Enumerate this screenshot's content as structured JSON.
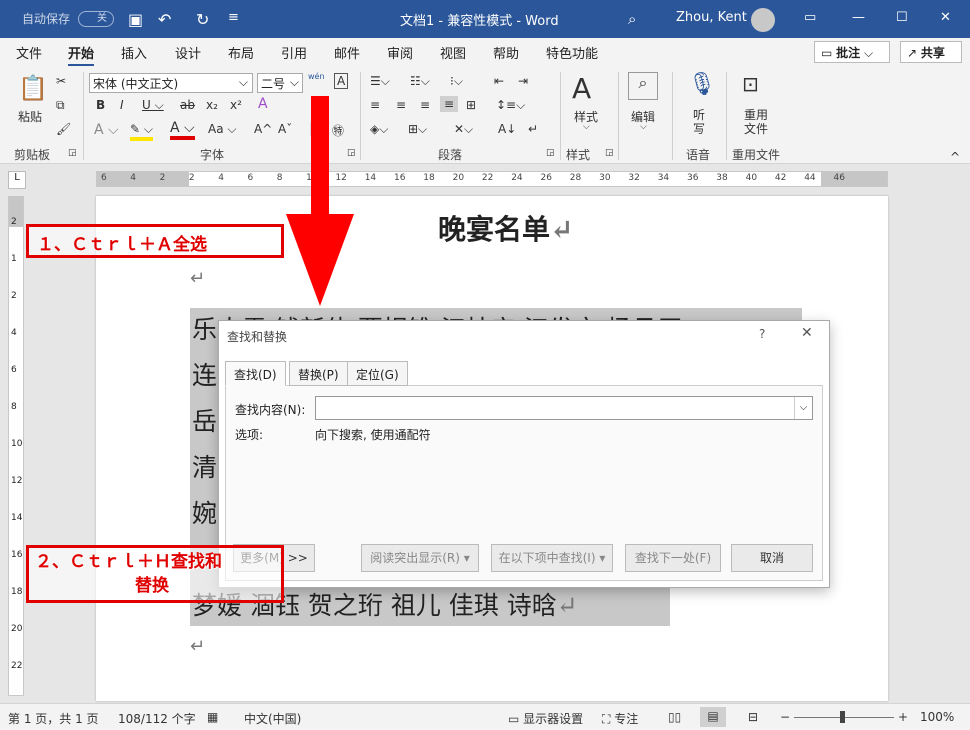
{
  "titlebar": {
    "autosave": "自动保存",
    "autosave_state": "关",
    "doc_title": "文档1 - 兼容性模式 - Word",
    "user": "Zhou, Kent"
  },
  "tabs": [
    "文件",
    "开始",
    "插入",
    "设计",
    "布局",
    "引用",
    "邮件",
    "审阅",
    "视图",
    "帮助",
    "特色功能"
  ],
  "comments_label": "批注",
  "share_label": "共享",
  "ribbon": {
    "paste": "粘贴",
    "clipboard": "剪贴板",
    "font_name": "宋体 (中文正文)",
    "font_size": "二号",
    "font_group": "字体",
    "para_group": "段落",
    "styles": "样式",
    "styles_group": "样式",
    "edit": "编辑",
    "dictate": "听写",
    "voice_group": "语音",
    "reuse": "重用文件",
    "reuse_group": "重用文件",
    "wen": "wén"
  },
  "ruler": [
    "6",
    "4",
    "2",
    "2",
    "4",
    "6",
    "8",
    "10",
    "12",
    "14",
    "16",
    "18",
    "20",
    "22",
    "24",
    "26",
    "28",
    "30",
    "32",
    "34",
    "36",
    "38",
    "40",
    "42",
    "44",
    "46"
  ],
  "vruler": [
    "2",
    "1",
    "2",
    "4",
    "6",
    "8",
    "10",
    "12",
    "14",
    "16",
    "18",
    "20",
    "22"
  ],
  "doc": {
    "title": "晚宴名单",
    "line1": "乐土雲 钱新伟 贾拐锥 江桔亲 江发文 杨月厂",
    "col": [
      "连",
      "岳",
      "清",
      "婉"
    ],
    "last": "梦嫒 涸钰 贺之珩 祖儿 佳琪 诗晗",
    "pilcrow": "↵"
  },
  "dialog": {
    "title": "查找和替换",
    "help": "?",
    "tabs": [
      "查找(D)",
      "替换(P)",
      "定位(G)"
    ],
    "find_label": "查找内容(N):",
    "find_value": "",
    "options_label": "选项:",
    "options_value": "向下搜索, 使用通配符",
    "more_btn": "更多(M) >>",
    "reading_btn": "阅读突出显示(R) ▾",
    "findin_btn": "在以下项中查找(I) ▾",
    "next_btn": "查找下一处(F)",
    "cancel_btn": "取消"
  },
  "annotations": {
    "step1": "１、Ｃｔｒｌ＋Ａ全选",
    "step2_line1": "２、Ｃｔｒｌ＋Ｈ查找和",
    "step2_line2": "替换"
  },
  "status": {
    "page": "第 1 页，共 1 页",
    "words": "108/112 个字",
    "lang": "中文(中国)",
    "display": "显示器设置",
    "focus": "专注",
    "zoom": "100%"
  },
  "colors": {
    "title_bg": "#2b579a",
    "annotation": "#e00000",
    "selection": "#c8c8c8"
  }
}
